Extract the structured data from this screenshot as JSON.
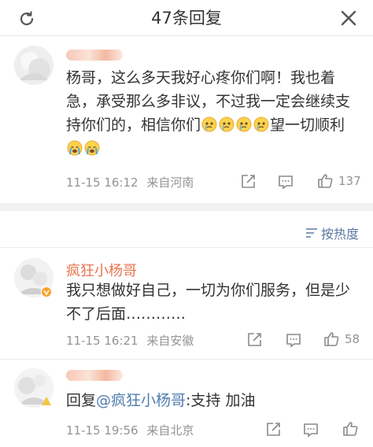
{
  "header": {
    "title": "47条回复",
    "refresh_icon": "refresh-icon",
    "close_icon": "close-icon"
  },
  "main_comment": {
    "name": "",
    "text_parts": [
      "杨哥，这么多天我好心疼你们啊！我也着急，承受那么多非议，不过我一定会继续支持你们的，相信你们",
      "望一切顺利"
    ],
    "emoji_crying": "crying-face",
    "time": "11-15 16:12",
    "location": "来自河南",
    "likes": "137"
  },
  "sort": {
    "label": "按热度",
    "icon": "sort-icon"
  },
  "replies": [
    {
      "name": "疯狂小杨哥",
      "text": "我只想做好自己，一切为你们服务，但是少不了后面…………",
      "time": "11-15 16:21",
      "location": "来自安徽",
      "likes": "58"
    },
    {
      "name": "",
      "prefix": "回复",
      "mention": "@疯狂小杨哥",
      "text": ":支持 加油",
      "time": "11-15 19:56",
      "location": "来自北京",
      "likes": ""
    }
  ],
  "colors": {
    "name": "#eb7350",
    "link": "#507daf",
    "meta": "#939393",
    "divider": "#f2f2f2"
  }
}
